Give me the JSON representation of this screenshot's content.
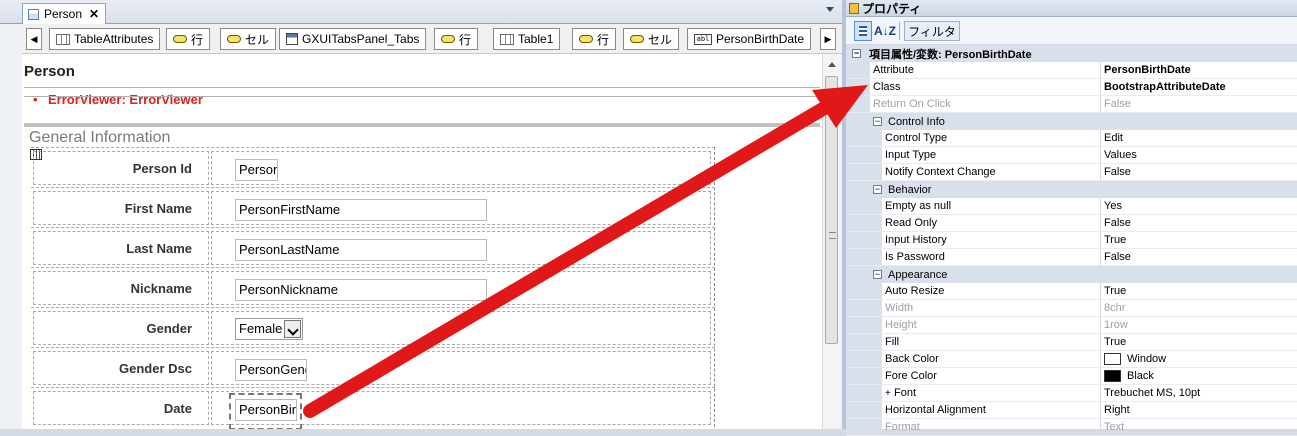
{
  "editor": {
    "doc_tab": "Person",
    "doc_tab_close": "✕",
    "crumbs": [
      "TableAttributes",
      "行",
      "セル",
      "GXUITabsPanel_Tabs",
      "行",
      "Table1",
      "行",
      "セル",
      "PersonBirthDate"
    ],
    "crumb_left": "◀",
    "crumb_right": "▶",
    "attr_icon_text": "abl",
    "page_title": "Person",
    "error_viewer": "ErrorViewer: ErrorViewer",
    "section_title": "General Information",
    "rows": [
      {
        "label": "Person Id",
        "value": "Person"
      },
      {
        "label": "First Name",
        "value": "PersonFirstName"
      },
      {
        "label": "Last Name",
        "value": "PersonLastName"
      },
      {
        "label": "Nickname",
        "value": "PersonNickname"
      },
      {
        "label": "Gender",
        "value": "Female"
      },
      {
        "label": "Gender Dsc",
        "value": "PersonGend"
      },
      {
        "label": "Date",
        "value": "PersonBirt"
      }
    ]
  },
  "properties": {
    "title": "プロパティ",
    "toolbar": {
      "sort_icon": "A↓Z",
      "filter_label": "フィルタ"
    },
    "header_row": "項目属性/変数: PersonBirthDate",
    "rows_top": [
      {
        "name": "Attribute",
        "value": "PersonBirthDate"
      },
      {
        "name": "Class",
        "value": "BootstrapAttributeDate"
      },
      {
        "name": "Return On Click",
        "value": "False"
      }
    ],
    "cat_control": "Control Info",
    "rows_control": [
      {
        "name": "Control Type",
        "value": "Edit"
      },
      {
        "name": "Input Type",
        "value": "Values"
      },
      {
        "name": "Notify Context Change",
        "value": "False"
      }
    ],
    "cat_behavior": "Behavior",
    "rows_behavior": [
      {
        "name": "Empty as null",
        "value": "Yes"
      },
      {
        "name": "Read Only",
        "value": "False"
      },
      {
        "name": "Input History",
        "value": "True"
      },
      {
        "name": "Is Password",
        "value": "False"
      }
    ],
    "cat_appearance": "Appearance",
    "rows_appearance": [
      {
        "name": "Auto Resize",
        "value": "True"
      },
      {
        "name": "Width",
        "value": "8chr"
      },
      {
        "name": "Height",
        "value": "1row"
      },
      {
        "name": "Fill",
        "value": "True"
      },
      {
        "name": "Back Color",
        "value": "Window",
        "swatch": "#ffffff"
      },
      {
        "name": "Fore Color",
        "value": "Black",
        "swatch": "#000000"
      },
      {
        "name": "Font",
        "value": "Trebuchet MS, 10pt"
      },
      {
        "name": "Horizontal Alignment",
        "value": "Right"
      },
      {
        "name": "Format",
        "value": "Text"
      }
    ]
  },
  "colors": {
    "arrow": "#e01818",
    "error_text": "#e02020"
  }
}
